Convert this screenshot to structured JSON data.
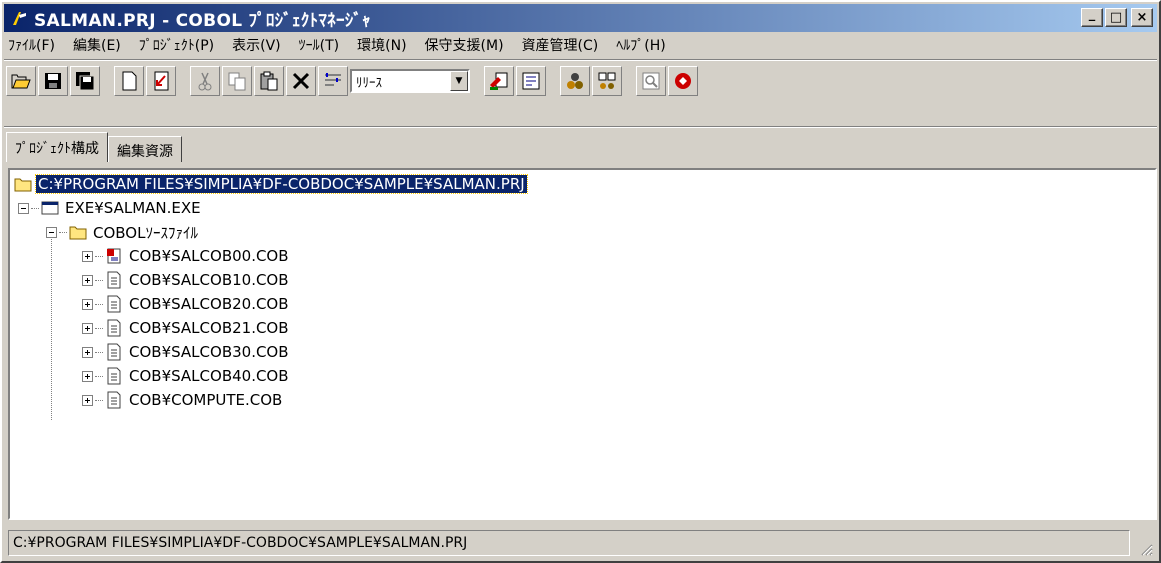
{
  "window": {
    "title": "SALMAN.PRJ - COBOL ﾌﾟﾛｼﾞｪｸﾄﾏﾈｰｼﾞｬ",
    "controls": [
      "_",
      "□",
      "×"
    ]
  },
  "menu": [
    "ﾌｧｲﾙ(F)",
    "編集(E)",
    "ﾌﾟﾛｼﾞｪｸﾄ(P)",
    "表示(V)",
    "ﾂｰﾙ(T)",
    "環境(N)",
    "保守支援(M)",
    "資産管理(C)",
    "ﾍﾙﾌﾟ(H)"
  ],
  "toolbar": {
    "build_mode": "ﾘﾘｰｽ",
    "icons": [
      "open-folder-icon",
      "save-icon",
      "save-all-icon",
      "new-document-icon",
      "import-icon",
      "cut-icon",
      "copy-icon",
      "paste-icon",
      "delete-icon",
      "properties-icon",
      "compile-icon",
      "rebuild-icon",
      "build-icon",
      "build-all-icon",
      "preview-icon",
      "execute-icon"
    ]
  },
  "tabs": [
    "ﾌﾟﾛｼﾞｪｸﾄ構成",
    "編集資源"
  ],
  "tree": {
    "root": "C:¥PROGRAM FILES¥SIMPLIA¥DF-COBDOC¥SAMPLE¥SALMAN.PRJ",
    "exe": "EXE¥SALMAN.EXE",
    "folder": "COBOLｿｰｽﾌｧｲﾙ",
    "files": [
      "COB¥SALCOB00.COB",
      "COB¥SALCOB10.COB",
      "COB¥SALCOB20.COB",
      "COB¥SALCOB21.COB",
      "COB¥SALCOB30.COB",
      "COB¥SALCOB40.COB",
      "COB¥COMPUTE.COB"
    ]
  },
  "status": {
    "path": "C:¥PROGRAM FILES¥SIMPLIA¥DF-COBDOC¥SAMPLE¥SALMAN.PRJ"
  },
  "colors": {
    "title_gradient_start": "#0a246a",
    "title_gradient_end": "#a6caf0",
    "selection": "#0a246a",
    "chrome": "#d4d0c8"
  }
}
